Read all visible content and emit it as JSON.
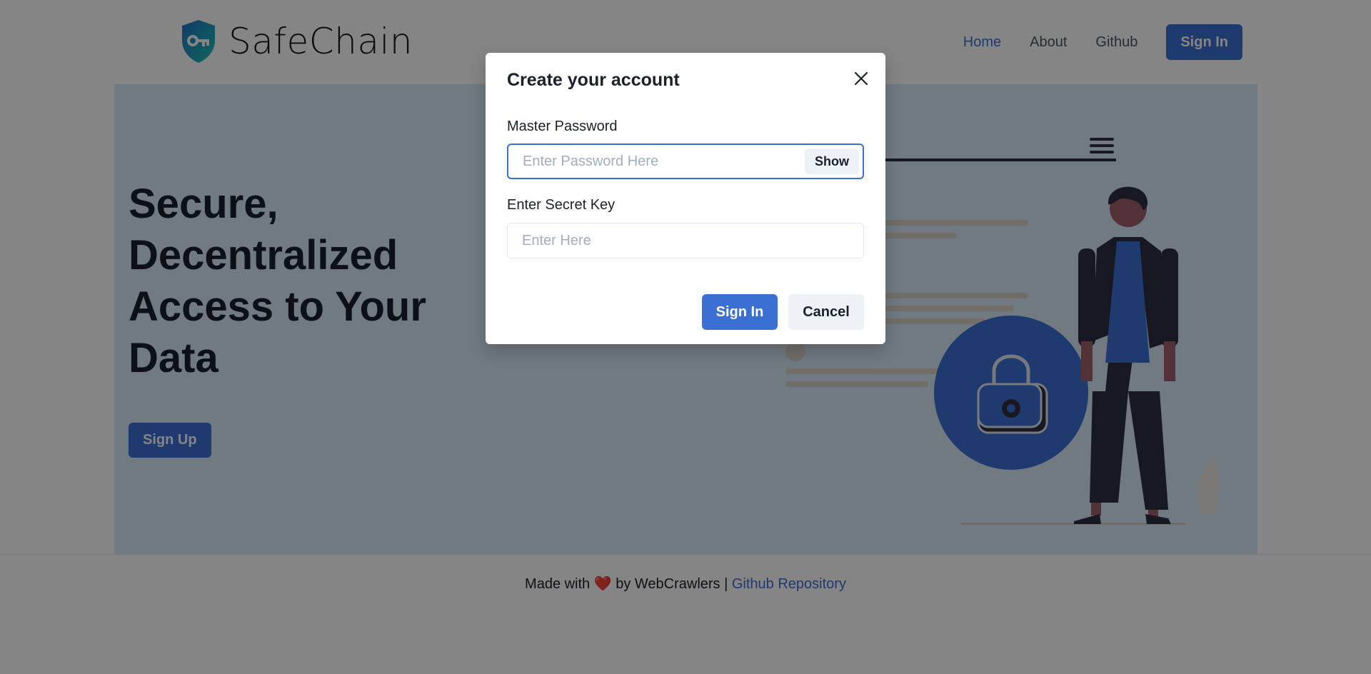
{
  "header": {
    "logo_text": "SafeChain",
    "nav": {
      "home": "Home",
      "about": "About",
      "github": "Github",
      "sign_in": "Sign In"
    }
  },
  "hero": {
    "title": "Secure, Decentralized Access to Your Data",
    "signup_label": "Sign Up"
  },
  "footer": {
    "made_with": "Made with",
    "heart": "❤️",
    "by": "by WebCrawlers |",
    "repo_link": "Github Repository"
  },
  "modal": {
    "title": "Create your account",
    "master_password_label": "Master Password",
    "master_password_placeholder": "Enter Password Here",
    "show_label": "Show",
    "secret_key_label": "Enter Secret Key",
    "secret_key_placeholder": "Enter Here",
    "sign_in_label": "Sign In",
    "cancel_label": "Cancel"
  },
  "colors": {
    "accent": "#3b6fd4",
    "hero_bg": "#d6eaf5",
    "overlay": "rgba(0,0,0,0.48)"
  }
}
